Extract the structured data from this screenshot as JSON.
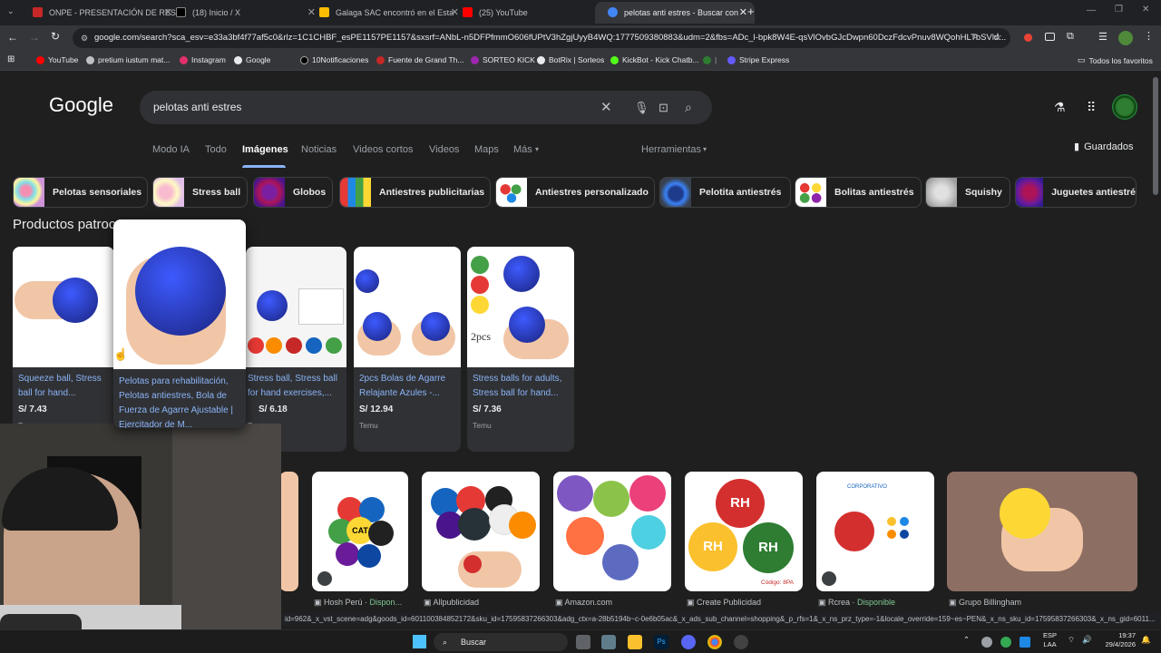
{
  "tabs": [
    {
      "title": "ONPE - PRESENTACIÓN DE RES",
      "color": "#c62828"
    },
    {
      "title": "(18) Inicio / X",
      "color": "#000000"
    },
    {
      "title": "Galaga SAC encontró en el Esta",
      "color": "#fbbc04"
    },
    {
      "title": "(25) YouTube",
      "color": "#ff0000"
    },
    {
      "title": "pelotas anti estres - Buscar con",
      "color": "#4285f4"
    }
  ],
  "address": "google.com/search?sca_esv=e33a3bf4f77af5c0&rlz=1C1CHBF_esPE1157PE1157&sxsrf=ANbL-n5DFPfmmO606fUPtV3hZgjUyyB4WQ:1777509380883&udm=2&fbs=ADc_l-bpk8W4E-qsVlOvbGJcDwpn60DczFdcvPnuv8WQohHLTbSVld...",
  "bookmarks": [
    "YouTube",
    "pretium iustum mat...",
    "Instagram",
    "Google",
    "10Notificaciones",
    "Fuente de Grand Th...",
    "SORTEO KICK",
    "BotRix | Sorteos",
    "KickBot - Kick Chatb...",
    "Stripe Express",
    "Todos los favoritos"
  ],
  "logo": "Google",
  "query": "pelotas anti estres",
  "nav": [
    "Modo IA",
    "Todo",
    "Imágenes",
    "Noticias",
    "Videos cortos",
    "Videos",
    "Maps",
    "Más",
    "Herramientas"
  ],
  "saved": "Guardados",
  "chips": [
    "Pelotas sensoriales",
    "Stress ball",
    "Globos",
    "Antiestres publicitarias",
    "Antiestres personalizado",
    "Pelotita antiestrés",
    "Bolitas antiestrés",
    "Squishy",
    "Juguetes antiestré"
  ],
  "sponsored": "Productos patroc",
  "products": [
    {
      "title": "Squeeze ball, Stress ball for hand...",
      "price": "S/ 7.43",
      "store": "Temu"
    },
    {
      "title": "Pelotas para rehabilitación, Pelotas antiestres, Bola de Fuerza de Agarre Ajustable | Ejercitador de M...",
      "price": "",
      "store": ""
    },
    {
      "title": "Stress ball, Stress ball for hand exercises,...",
      "price": "S/ 6.18",
      "store": "Temu"
    },
    {
      "title": "2pcs Bolas de Agarre Relajante Azules -...",
      "price": "S/ 12.94",
      "store": "Temu"
    },
    {
      "title": "Stress balls for adults, Stress ball for hand...",
      "price": "S/ 7.36",
      "store": "Temu"
    }
  ],
  "image_sources": [
    {
      "name": "Hosh Perú",
      "extra": "Dispon..."
    },
    {
      "name": "Allpublicidad",
      "extra": ""
    },
    {
      "name": "Amazon.com",
      "extra": ""
    },
    {
      "name": "Create Publicidad",
      "extra": ""
    },
    {
      "name": "Rcrea",
      "extra": "Disponible"
    },
    {
      "name": "Grupo Billingham",
      "extra": ""
    }
  ],
  "image_text": {
    "rh": "RH",
    "code": "Código: 8PA",
    "corp": "CORPORATIVO",
    "twopcs": "2pcs",
    "cat": "CAT"
  },
  "status_url": "id=962&_x_vst_scene=adg&goods_id=601100384852172&sku_id=17595837266303&adg_ctx=a-28b5194b~c-0e6b05ac&_x_ads_sub_channel=shopping&_p_rfs=1&_x_ns_prz_type=-1&locale_override=159~es~PEN&_x_ns_sku_id=17595837266303&_x_ns_gid=6011...",
  "taskbar": {
    "search": "Buscar",
    "lang1": "ESP",
    "lang2": "LAA",
    "time": "19:37",
    "date": "29/4/2026"
  }
}
